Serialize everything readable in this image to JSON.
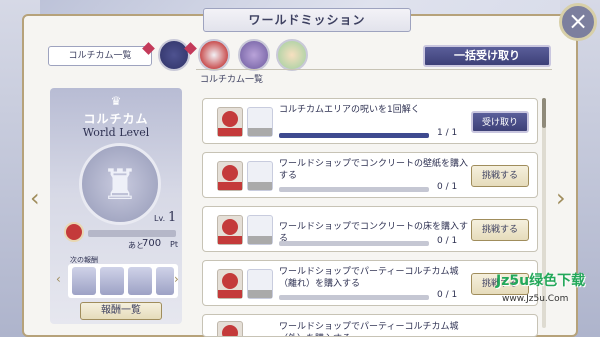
{
  "header": {
    "title": "ワールドミッション"
  },
  "top": {
    "section_label": "コルチカム一覧",
    "claim_all_label": "一括受け取り",
    "list_label": "コルチカム一覧"
  },
  "left_card": {
    "title": "コルチカム",
    "subtitle": "World Level",
    "level_prefix": "Lv.",
    "level": "1",
    "points_prefix": "あと",
    "points": "700",
    "points_unit": "Pt",
    "next_reward_label": "次の報酬",
    "reward_button": "報酬一覧"
  },
  "missions": [
    {
      "text": "コルチカムエリアの呪いを1回解く",
      "progress": "1",
      "total": "1",
      "fraction": 1,
      "button": "受け取り"
    },
    {
      "text": "ワールドショップでコンクリートの壁紙を購入する",
      "progress": "0",
      "total": "1",
      "fraction": 0,
      "button": "挑戦する"
    },
    {
      "text": "ワールドショップでコンクリートの床を購入する",
      "progress": "0",
      "total": "1",
      "fraction": 0,
      "button": "挑戦する"
    },
    {
      "text": "ワールドショップでパーティーコルチカム城（離れ）を購入する",
      "progress": "0",
      "total": "1",
      "fraction": 0,
      "button": "挑戦する"
    },
    {
      "text": "ワールドショップでパーティーコルチカム城（外）を購入する"
    }
  ],
  "watermark": {
    "main": "Jz5u绿色下载",
    "sub": "www.Jz5u.Com"
  },
  "icons": {
    "close": "close-icon",
    "left_nav": "chevron-left-icon",
    "right_nav": "chevron-right-icon"
  },
  "colors": {
    "accent": "#3d4077",
    "gold": "#a08d5c",
    "red": "#c43a3a"
  }
}
